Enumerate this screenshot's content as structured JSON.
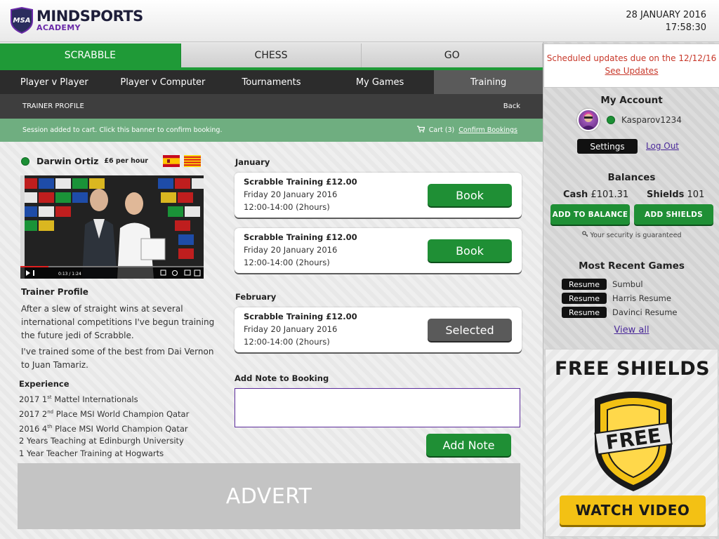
{
  "header": {
    "logo_badge": "MSA",
    "logo_main": "MINDSPORTS",
    "logo_sub": "ACADEMY",
    "date": "28 JANUARY 2016",
    "time": "17:58:30"
  },
  "game_tabs": [
    {
      "label": "SCRABBLE",
      "active": true
    },
    {
      "label": "CHESS",
      "active": false
    },
    {
      "label": "GO",
      "active": false
    }
  ],
  "subnav": [
    {
      "label": "Player v Player"
    },
    {
      "label": "Player  v Computer"
    },
    {
      "label": "Tournaments"
    },
    {
      "label": "My Games"
    },
    {
      "label": "Training",
      "active": true
    }
  ],
  "trainer_bar": {
    "title": "TRAINER PROFILE",
    "back": "Back"
  },
  "banner": {
    "message": "Session added to cart. Click this banner to confirm booking.",
    "cart": "Cart (3)",
    "confirm": "Confirm Bookings"
  },
  "trainer": {
    "name": "Darwin Ortiz",
    "rate": "£6 per hour",
    "video_time": "0:13 / 1:24",
    "profile_title": "Trainer Profile",
    "profile_p1": "After a slew of straight wins at several international competitions I've begun training the future jedi of Scrabble.",
    "profile_p2": "I've trained some of the best from Dai Vernon to Juan Tamariz.",
    "experience_title": "Experience",
    "experience": [
      {
        "pre": "2017 1",
        "sup": "st",
        "post": " Mattel Internationals"
      },
      {
        "pre": "2017 2",
        "sup": "nd",
        "post": " Place MSI World Champion Qatar"
      },
      {
        "pre": "2016 4",
        "sup": "th",
        "post": " Place MSI World Champion Qatar"
      },
      {
        "pre": "2 Years Teaching at Edinburgh University",
        "sup": "",
        "post": ""
      },
      {
        "pre": "1 Year Teacher Training at Hogwarts",
        "sup": "",
        "post": ""
      }
    ]
  },
  "sessions": {
    "january_label": "January",
    "february_label": "February",
    "items": [
      {
        "title": "Scrabble Training £12.00",
        "date": "Friday 20 January 2016",
        "time": "12:00-14:00 (2hours)",
        "button": "Book"
      },
      {
        "title": "Scrabble Training £12.00",
        "date": "Friday 20 January 2016",
        "time": "12:00-14:00 (2hours)",
        "button": "Book"
      },
      {
        "title": "Scrabble Training £12.00",
        "date": "Friday 20 January 2016",
        "time": "12:00-14:00 (2hours)",
        "button": "Selected"
      }
    ]
  },
  "note": {
    "label": "Add Note to Booking",
    "value": "",
    "button": "Add Note"
  },
  "advert": "ADVERT",
  "sidebar": {
    "updates_text": "Scheduled updates due on the 12/12/16",
    "updates_link": "See Updates",
    "account_title": "My Account",
    "username": "Kasparov1234",
    "settings": "Settings",
    "logout": "Log Out",
    "balances_title": "Balances",
    "cash_label": "Cash",
    "cash_value": "£101.31",
    "shields_label": "Shields",
    "shields_value": "101",
    "add_balance": "ADD TO BALANCE",
    "add_shields": "ADD SHIELDS",
    "security": "Your security is guaranteed",
    "recent_title": "Most Recent Games",
    "recent_games": [
      {
        "button": "Resume",
        "opponent": "Sumbul"
      },
      {
        "button": "Resume",
        "opponent": "Harris Resume"
      },
      {
        "button": "Resume",
        "opponent": "Davinci Resume"
      }
    ],
    "view_all": "View all",
    "promo_title": "FREE SHIELDS",
    "promo_shield_text": "FREE",
    "promo_button": "WATCH VIDEO"
  },
  "colors": {
    "brand_green": "#1f9a37",
    "brand_purple": "#6a2aa8",
    "alert_red": "#c8382a",
    "promo_yellow": "#f3c114"
  }
}
